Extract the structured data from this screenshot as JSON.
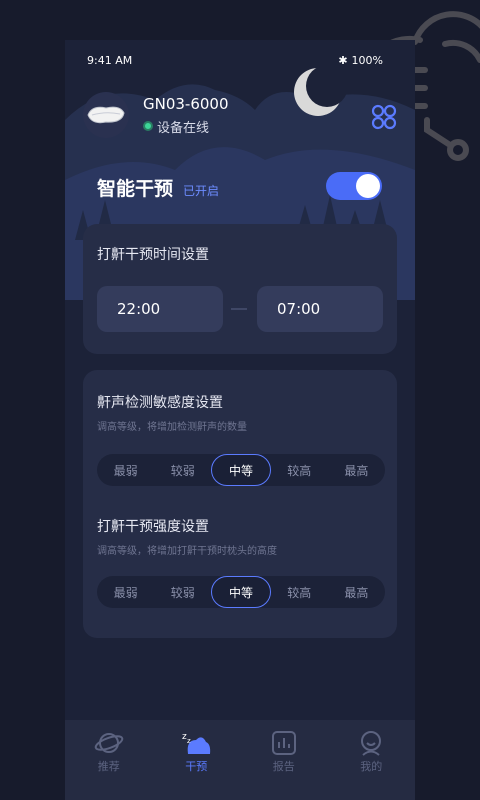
{
  "status_bar": {
    "time": "9:41 AM",
    "battery": "100%"
  },
  "device": {
    "name": "GN03-6000",
    "status": "设备在线"
  },
  "smart": {
    "title": "智能干预",
    "state": "已开启"
  },
  "time_setting": {
    "title": "打鼾干预时间设置",
    "start": "22:00",
    "end": "07:00"
  },
  "sensitivity": {
    "title": "鼾声检测敏感度设置",
    "hint": "调高等级，将增加检测鼾声的数量",
    "options": [
      "最弱",
      "较弱",
      "中等",
      "较高",
      "最高"
    ],
    "selected": "中等"
  },
  "intensity": {
    "title": "打鼾干预强度设置",
    "hint": "调高等级，将增加打鼾干预时枕头的高度",
    "options": [
      "最弱",
      "较弱",
      "中等",
      "较高",
      "最高"
    ],
    "selected": "中等"
  },
  "tabs": [
    {
      "label": "推荐",
      "icon": "planet-icon"
    },
    {
      "label": "干预",
      "icon": "sleep-icon",
      "active": true
    },
    {
      "label": "报告",
      "icon": "report-icon"
    },
    {
      "label": "我的",
      "icon": "user-icon"
    }
  ],
  "colors": {
    "accent": "#5b7bff",
    "online": "#3dd598",
    "background": "#1c2238",
    "card": "#262d47"
  }
}
